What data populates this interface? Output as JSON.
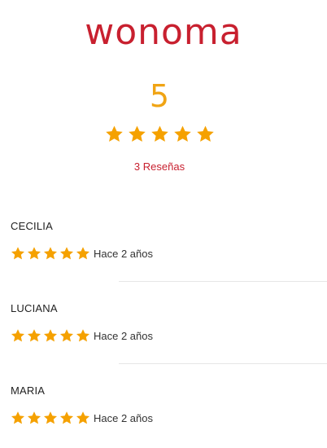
{
  "brand": {
    "logo_text": "wonoma"
  },
  "summary": {
    "score": "5",
    "stars": 5,
    "review_count_label": "3 Reseñas"
  },
  "reviews": [
    {
      "name": "CECILIA",
      "rating": 5,
      "date": "Hace 2 años"
    },
    {
      "name": "LUCIANA",
      "rating": 5,
      "date": "Hace 2 años"
    },
    {
      "name": "MARIA",
      "rating": 5,
      "date": "Hace 2 años"
    }
  ],
  "colors": {
    "brand_red": "#c8202f",
    "star_orange": "#f5a100",
    "score_orange": "#f0a414"
  },
  "icons": {
    "rating_star": "star-icon"
  }
}
